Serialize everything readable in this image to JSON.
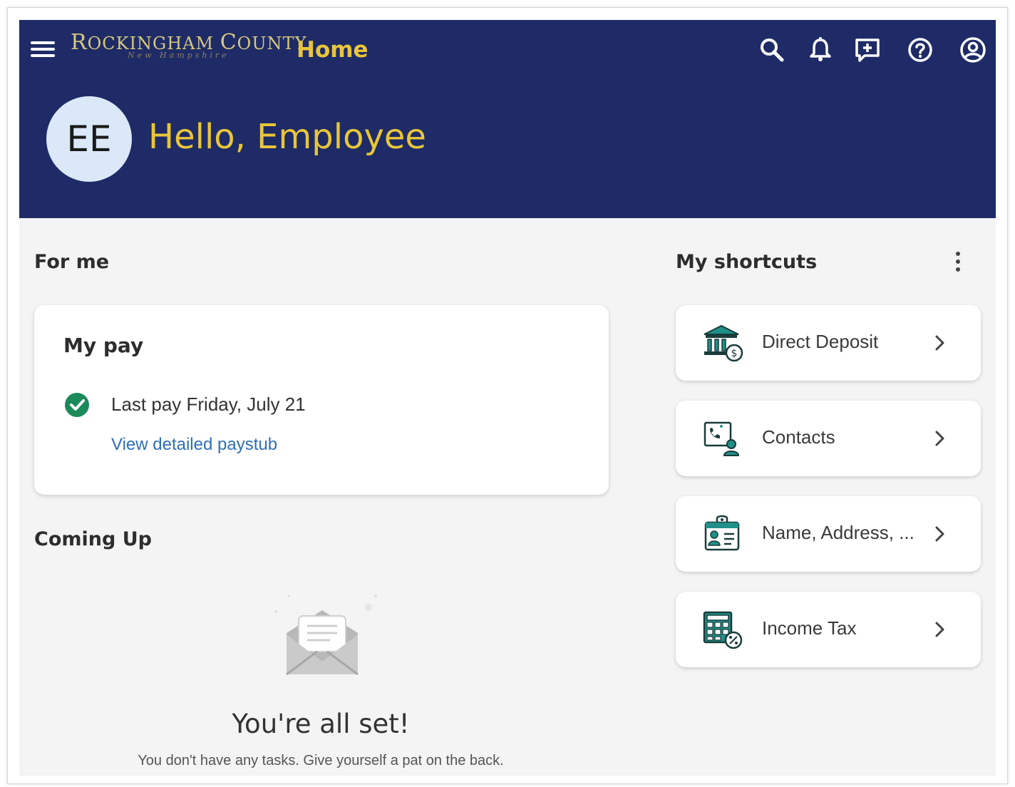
{
  "header": {
    "logo": {
      "line1_initial_r": "R",
      "line1_rest": "OCKINGHAM ",
      "line1_initial_c": "C",
      "line1_end": "OUNTY",
      "script": "New Hampshire"
    },
    "page_title": "Home",
    "icons": [
      "menu-icon",
      "search-icon",
      "bell-icon",
      "feedback-icon",
      "help-icon",
      "account-icon"
    ],
    "avatar_initials": "EE",
    "greeting": "Hello, Employee",
    "background_color": "#1e2b66",
    "accent_color": "#e8c53a"
  },
  "for_me": {
    "title": "For me",
    "my_pay": {
      "title": "My pay",
      "status": "Last pay Friday, July 21",
      "status_icon": "check-circle-icon",
      "link": "View detailed paystub"
    }
  },
  "coming_up": {
    "title": "Coming Up",
    "empty_title": "You're all set!",
    "empty_subtitle": "You don't have any tasks. Give yourself a pat on the back."
  },
  "shortcuts": {
    "title": "My shortcuts",
    "items": [
      {
        "label": "Direct Deposit",
        "icon": "bank-icon"
      },
      {
        "label": "Contacts",
        "icon": "contact-phone-icon"
      },
      {
        "label": "Name, Address, ...",
        "icon": "id-card-icon"
      },
      {
        "label": "Income Tax",
        "icon": "tax-calculator-icon"
      }
    ]
  }
}
